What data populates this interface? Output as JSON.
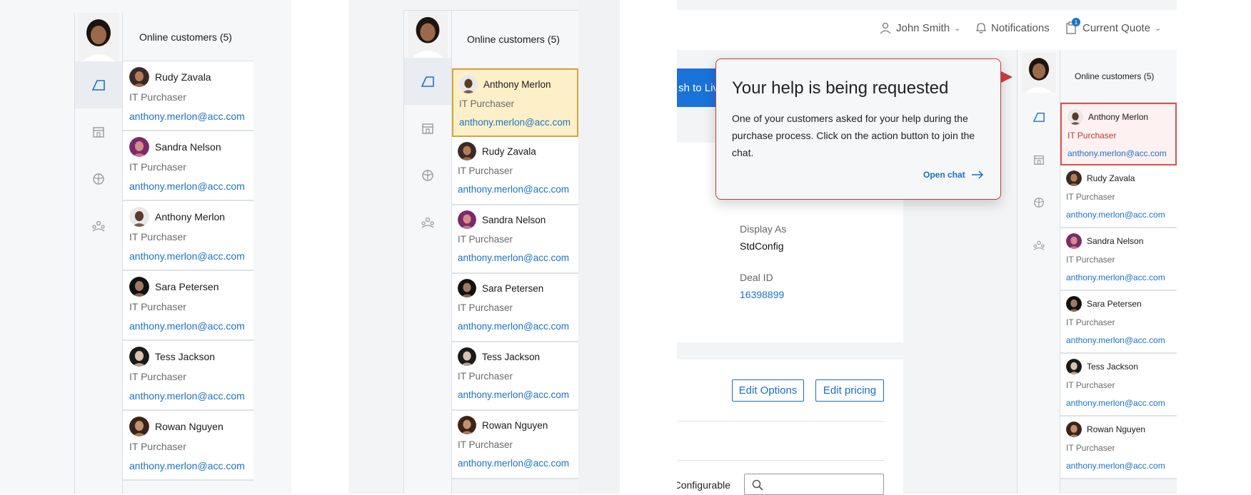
{
  "colors": {
    "accent": "#1a73c8",
    "highlight_yellow": "#fdf0c8",
    "highlight_red": "#d9534f",
    "panel_gray": "#f6f7f8"
  },
  "panel1": {
    "header": "Online customers (5)",
    "nav_icons": [
      "quote-icon",
      "store-icon",
      "globe-icon",
      "team-icon"
    ],
    "customers": [
      {
        "name": "Rudy Zavala",
        "role": "IT Purchaser",
        "email": "anthony.merlon@acc.com"
      },
      {
        "name": "Sandra Nelson",
        "role": "IT Purchaser",
        "email": "anthony.merlon@acc.com"
      },
      {
        "name": "Anthony Merlon",
        "role": "IT Purchaser",
        "email": "anthony.merlon@acc.com"
      },
      {
        "name": "Sara Petersen",
        "role": "IT Purchaser",
        "email": "anthony.merlon@acc.com"
      },
      {
        "name": "Tess Jackson",
        "role": "IT Purchaser",
        "email": "anthony.merlon@acc.com"
      },
      {
        "name": "Rowan Nguyen",
        "role": "IT Purchaser",
        "email": "anthony.merlon@acc.com"
      }
    ]
  },
  "panel2": {
    "header": "Online customers (5)",
    "customers": [
      {
        "name": "Anthony Merlon",
        "role": "IT Purchaser",
        "email": "anthony.merlon@acc.com"
      },
      {
        "name": "Rudy Zavala",
        "role": "IT Purchaser",
        "email": "anthony.merlon@acc.com"
      },
      {
        "name": "Sandra Nelson",
        "role": "IT Purchaser",
        "email": "anthony.merlon@acc.com"
      },
      {
        "name": "Sara Petersen",
        "role": "IT Purchaser",
        "email": "anthony.merlon@acc.com"
      },
      {
        "name": "Tess Jackson",
        "role": "IT Purchaser",
        "email": "anthony.merlon@acc.com"
      },
      {
        "name": "Rowan Nguyen",
        "role": "IT Purchaser",
        "email": "anthony.merlon@acc.com"
      }
    ]
  },
  "panel3": {
    "topbar": {
      "user": "John Smith",
      "notifications": "Notifications",
      "quote": "Current Quote",
      "quote_badge": "1"
    },
    "push_button_fragment": "sh to Liv",
    "popup": {
      "title": "Your help is being requested",
      "body": "One of your customers asked for your help during the purchase process. Click on the action button to join the chat.",
      "action": "Open chat"
    },
    "fields": {
      "display_as_label": "Display As",
      "display_as_value": "StdConfig",
      "deal_id_label": "Deal ID",
      "deal_id_value": "16398899"
    },
    "buttons": {
      "edit_options": "Edit Options",
      "edit_pricing": "Edit pricing"
    },
    "configurable_label": "Configurable",
    "list": {
      "header": "Online customers (5)",
      "customers": [
        {
          "name": "Anthony Merlon",
          "role": "IT Purchaser",
          "email": "anthony.merlon@acc.com"
        },
        {
          "name": "Rudy Zavala",
          "role": "IT Purchaser",
          "email": "anthony.merlon@acc.com"
        },
        {
          "name": "Sandra Nelson",
          "role": "IT Purchaser",
          "email": "anthony.merlon@acc.com"
        },
        {
          "name": "Sara Petersen",
          "role": "IT Purchaser",
          "email": "anthony.merlon@acc.com"
        },
        {
          "name": "Tess Jackson",
          "role": "IT Purchaser",
          "email": "anthony.merlon@acc.com"
        },
        {
          "name": "Rowan Nguyen",
          "role": "IT Purchaser",
          "email": "anthony.merlon@acc.com"
        }
      ]
    }
  }
}
